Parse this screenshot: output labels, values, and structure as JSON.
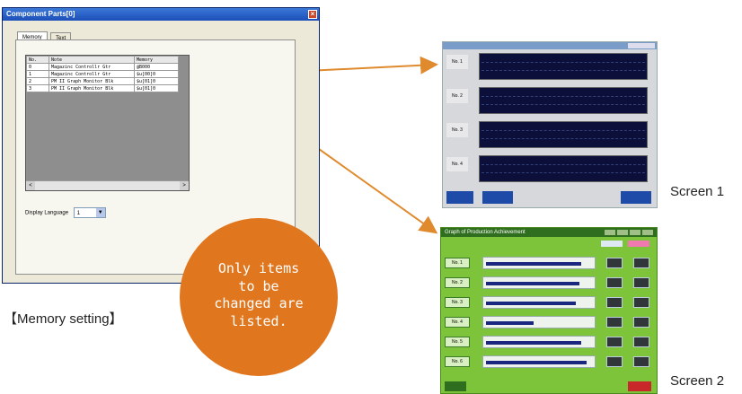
{
  "memory_dialog": {
    "title": "Component Parts[0]",
    "close_glyph": "×",
    "tabs": [
      "Memory",
      "Text"
    ],
    "columns": [
      "No.",
      "Note",
      "Memory"
    ],
    "rows": [
      [
        "0",
        "Magazinc Controllr Gtr",
        "@B000"
      ],
      [
        "1",
        "Magazinc Controllr Gtr",
        "$u[00]0"
      ],
      [
        "2",
        "PM II Graph Monitor Blk",
        "$u[01]0"
      ],
      [
        "3",
        "PM II Graph Monitor Blk",
        "$u[01]0"
      ]
    ],
    "scroll_left": "<",
    "scroll_right": ">",
    "language_label": "Display Language",
    "language_value": "1",
    "dropdown_glyph": "▼"
  },
  "memory_caption": "【Memory setting】",
  "bubble_text": [
    "Only items",
    "to be",
    "changed are",
    "listed."
  ],
  "screen1": {
    "caption": "Screen 1",
    "rows": [
      "No. 1",
      "No. 2",
      "No. 3",
      "No. 4"
    ]
  },
  "screen2": {
    "caption": "Screen 2",
    "title": "Graph of Production Achievement",
    "rows": [
      "No. 1",
      "No. 2",
      "No. 3",
      "No. 4",
      "No. 5",
      "No. 6"
    ],
    "progress": [
      0.9,
      0.88,
      0.85,
      0.45,
      0.9,
      0.95
    ]
  },
  "colors": {
    "bubble": "#e0761e",
    "arrow": "#e08a2e",
    "screen1_plot": "#0b0f3a",
    "screen2_bg": "#7ec43a"
  }
}
